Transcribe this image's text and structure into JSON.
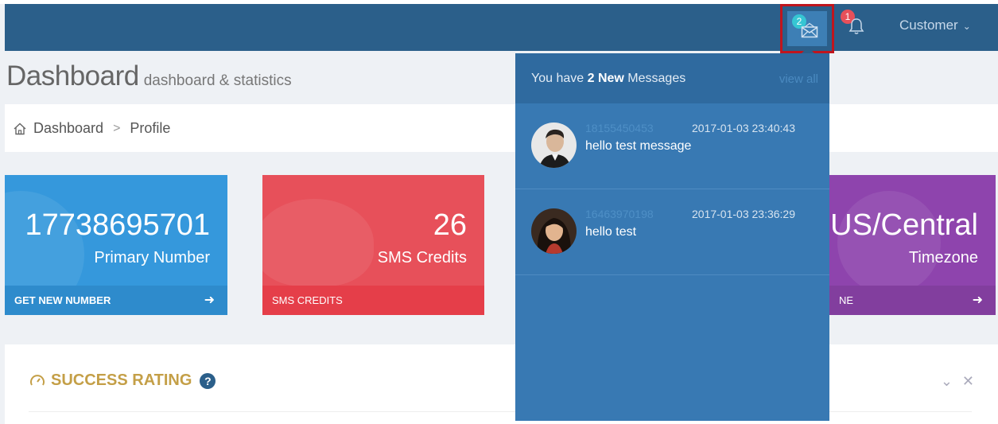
{
  "header": {
    "messages_badge": "2",
    "notifications_badge": "1",
    "user_label": "Customer"
  },
  "page": {
    "title": "Dashboard",
    "subtitle": "dashboard & statistics"
  },
  "breadcrumb": {
    "items": [
      "Dashboard",
      "Profile"
    ],
    "separator": ">"
  },
  "tiles": [
    {
      "value": "17738695701",
      "label": "Primary Number",
      "footer": "GET NEW NUMBER",
      "color": "#3598dc"
    },
    {
      "value": "26",
      "label": "SMS Credits",
      "footer": "SMS CREDITS",
      "color": "#e7505a"
    },
    {
      "value": "US/Central",
      "label": "Timezone",
      "footer": "NE",
      "color": "#8e44ad"
    }
  ],
  "portlet": {
    "title": "SUCCESS RATING",
    "help_glyph": "?"
  },
  "messages_dropdown": {
    "header_prefix": "You have ",
    "header_bold": "2 New",
    "header_suffix": " Messages",
    "view_all": "view all",
    "items": [
      {
        "from": "18155450453",
        "time": "2017-01-03 23:40:43",
        "text": "hello test message",
        "avatar": "man-avatar"
      },
      {
        "from": "16463970198",
        "time": "2017-01-03 23:36:29",
        "text": "hello test",
        "avatar": "woman-avatar"
      }
    ]
  },
  "icons": {
    "messages": "envelope-icon",
    "notifications": "bell-icon",
    "home": "home-icon",
    "arrow": "arrow-circle-right-icon",
    "rating": "speedometer-icon",
    "help": "question-circle-icon",
    "collapse": "chevron-down-icon",
    "close": "close-icon"
  }
}
